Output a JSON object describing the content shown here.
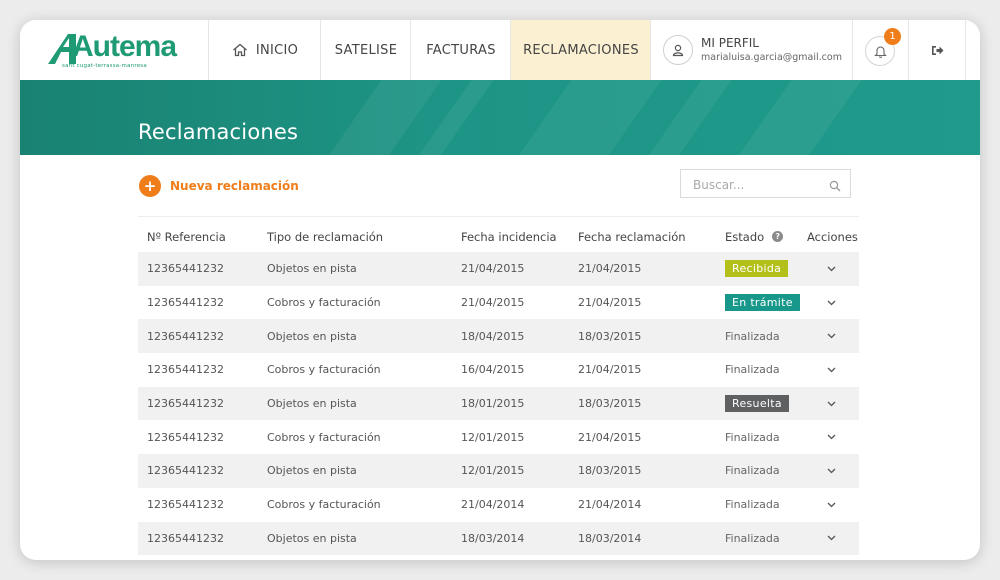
{
  "header": {
    "logo_text": "Autema",
    "logo_subtitle": "sant cugat-terrassa-manresa",
    "nav": [
      {
        "label": "INICIO",
        "icon": "home-icon"
      },
      {
        "label": "SATELISE"
      },
      {
        "label": "FACTURAS"
      },
      {
        "label": "RECLAMACIONES",
        "active": true
      }
    ],
    "profile": {
      "label": "MI PERFIL",
      "email": "marialuisa.garcia@gmail.com",
      "icon": "user-icon"
    },
    "notifications": {
      "count": "1",
      "icon": "bell-icon"
    },
    "logout_icon": "logout-icon"
  },
  "banner": {
    "title": "Reclamaciones"
  },
  "toolbar": {
    "new_label": "Nueva reclamación",
    "new_icon": "plus-icon",
    "search_placeholder": "Buscar...",
    "search_icon": "search-icon"
  },
  "table": {
    "columns": [
      "Nº Referencia",
      "Tipo de reclamación",
      "Fecha incidencia",
      "Fecha reclamación",
      "Estado",
      "Acciones"
    ],
    "rows": [
      {
        "ref": "12365441232",
        "tipo": "Objetos en pista",
        "incidencia": "21/04/2015",
        "reclamacion": "21/04/2015",
        "estado": "Recibida",
        "estado_style": "tag",
        "estado_color": "#b3c01a"
      },
      {
        "ref": "12365441232",
        "tipo": "Cobros y facturación",
        "incidencia": "21/04/2015",
        "reclamacion": "21/04/2015",
        "estado": "En trámite",
        "estado_style": "tag",
        "estado_color": "#17988a"
      },
      {
        "ref": "12365441232",
        "tipo": "Objetos en pista",
        "incidencia": "18/04/2015",
        "reclamacion": "18/03/2015",
        "estado": "Finalizada",
        "estado_style": "text"
      },
      {
        "ref": "12365441232",
        "tipo": "Cobros y facturación",
        "incidencia": "16/04/2015",
        "reclamacion": "21/04/2015",
        "estado": "Finalizada",
        "estado_style": "text"
      },
      {
        "ref": "12365441232",
        "tipo": "Objetos en pista",
        "incidencia": "18/01/2015",
        "reclamacion": "18/03/2015",
        "estado": "Resuelta",
        "estado_style": "tag",
        "estado_color": "#5f6062"
      },
      {
        "ref": "12365441232",
        "tipo": "Cobros y facturación",
        "incidencia": "12/01/2015",
        "reclamacion": "21/04/2015",
        "estado": "Finalizada",
        "estado_style": "text"
      },
      {
        "ref": "12365441232",
        "tipo": "Objetos en pista",
        "incidencia": "12/01/2015",
        "reclamacion": "18/03/2015",
        "estado": "Finalizada",
        "estado_style": "text"
      },
      {
        "ref": "12365441232",
        "tipo": "Cobros y facturación",
        "incidencia": "21/04/2014",
        "reclamacion": "21/04/2014",
        "estado": "Finalizada",
        "estado_style": "text"
      },
      {
        "ref": "12365441232",
        "tipo": "Objetos en pista",
        "incidencia": "18/03/2014",
        "reclamacion": "18/03/2014",
        "estado": "Finalizada",
        "estado_style": "text"
      }
    ]
  },
  "colors": {
    "brand": "#1e9a75",
    "accent": "#ef7d1a",
    "banner": "#1d9586",
    "active_nav": "#fbf0d2"
  }
}
